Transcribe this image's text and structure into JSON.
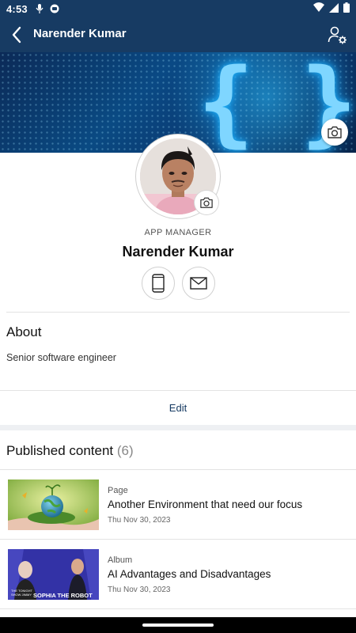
{
  "status_bar": {
    "time": "4:53"
  },
  "app_bar": {
    "title": "Narender Kumar"
  },
  "profile": {
    "role": "APP MANAGER",
    "name": "Narender Kumar"
  },
  "about": {
    "heading": "About",
    "text": "Senior software engineer",
    "edit_label": "Edit"
  },
  "published": {
    "heading": "Published content",
    "count": "(6)",
    "items": [
      {
        "type": "Page",
        "title": "Another Environment that need our focus",
        "date": "Thu Nov 30, 2023"
      },
      {
        "type": "Album",
        "title": "AI Advantages and Disadvantages",
        "date": "Thu Nov 30, 2023",
        "thumb_caption": "SOPHIA THE ROBOT",
        "thumb_logo": "THE TONIGHT SHOW STARRING JIMMY FALLON"
      }
    ]
  },
  "colors": {
    "header": "#173b63",
    "accent": "#173b63",
    "divider": "#e3e3e3"
  },
  "icons": [
    "back-arrow-icon",
    "user-settings-icon",
    "camera-icon",
    "phone-icon",
    "mail-icon"
  ]
}
